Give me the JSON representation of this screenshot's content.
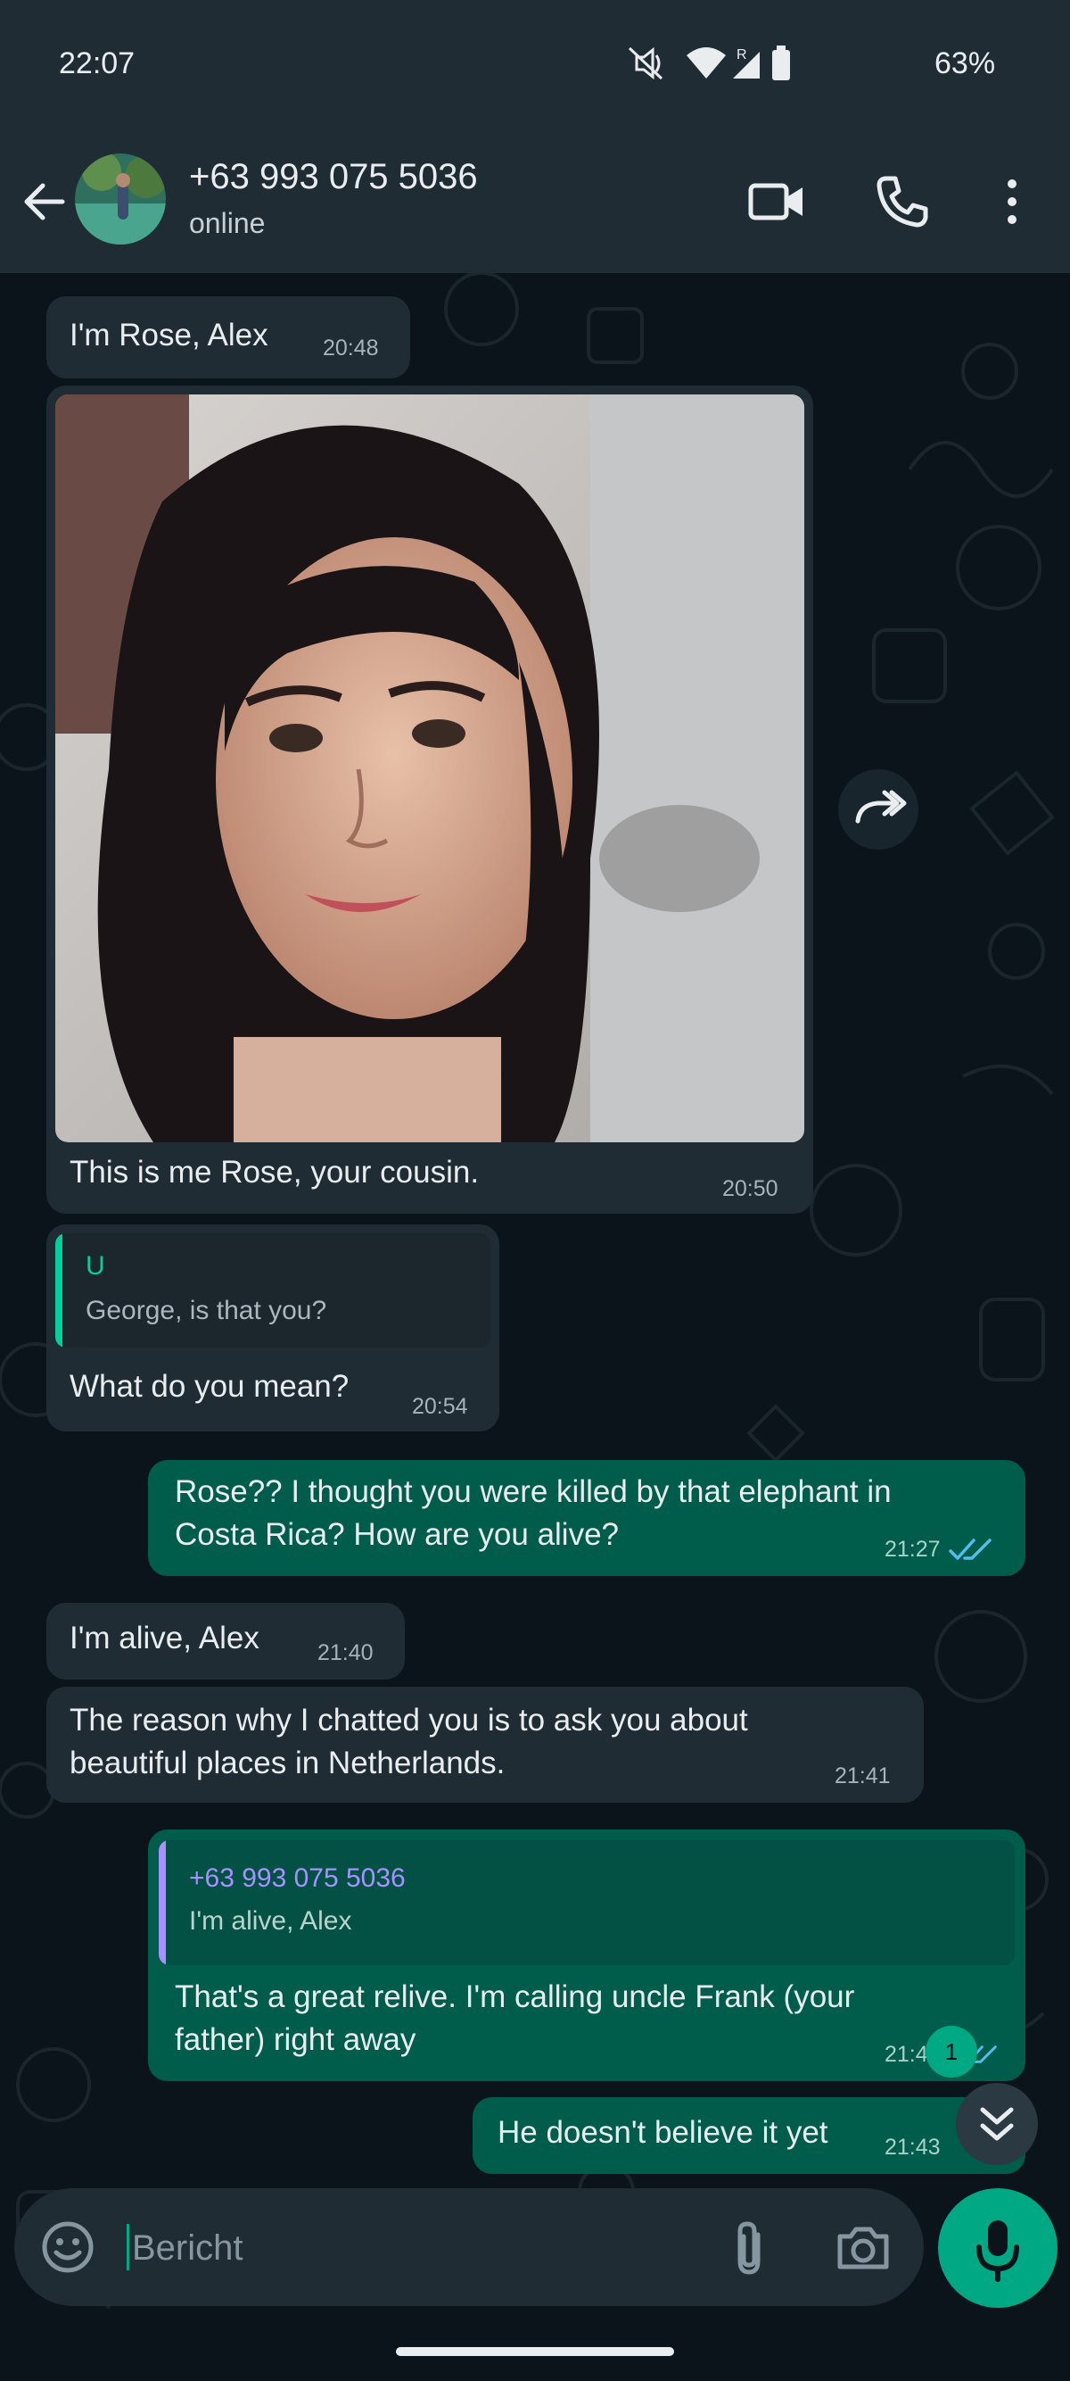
{
  "status_bar": {
    "time": "22:07",
    "battery": "63%",
    "icons": [
      "mute-icon",
      "wifi-icon",
      "signal-roaming-icon",
      "battery-icon"
    ]
  },
  "header": {
    "contact_name": "+63 993 075 5036",
    "contact_status": "online",
    "icons": [
      "back-arrow-icon",
      "video-call-icon",
      "phone-icon",
      "more-vert-icon"
    ]
  },
  "messages": {
    "m1": {
      "text": "I'm Rose, Alex",
      "time": "20:48"
    },
    "m2": {
      "caption": "This is me Rose, your cousin.",
      "time": "20:50"
    },
    "m3": {
      "quote_author": "U",
      "quote_text": "George, is that you?",
      "text": "What do you mean?",
      "time": "20:54"
    },
    "m4": {
      "line1": "Rose?? I thought you were killed by that elephant in",
      "line2": "Costa Rica? How are you alive?",
      "time": "21:27"
    },
    "m5": {
      "text": "I'm alive, Alex",
      "time": "21:40"
    },
    "m6": {
      "line1": "The reason why I chatted you is to ask you about",
      "line2": "beautiful places in Netherlands.",
      "time": "21:41"
    },
    "m7": {
      "quote_author": "+63 993 075 5036",
      "quote_text": "I'm alive, Alex",
      "line1": "That's a great relive. I'm calling uncle Frank (your",
      "line2": "father) right away",
      "time": "21:4"
    },
    "m8": {
      "text": "He doesn't believe it yet",
      "time": "21:43"
    }
  },
  "unread_count": "1",
  "composer": {
    "placeholder": "Bericht"
  },
  "colors": {
    "background": "#0b141a",
    "header": "#1f2c34",
    "incoming_bubble": "#1f2c34",
    "outgoing_bubble": "#005c4b",
    "accent": "#00a884",
    "read_ticks": "#53bdeb"
  }
}
